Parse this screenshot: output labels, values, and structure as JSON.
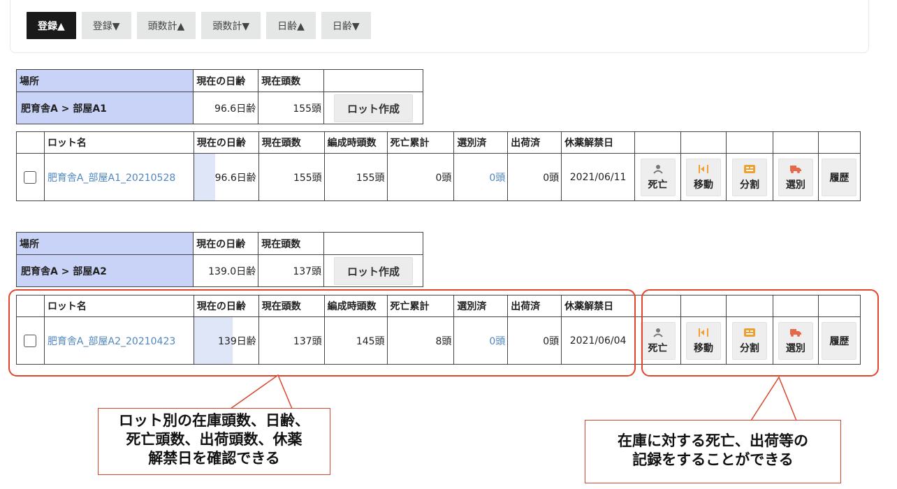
{
  "sort_buttons": [
    "登録▲",
    "登録▼",
    "頭数計▲",
    "頭数計▼",
    "日齢▲",
    "日齢▼"
  ],
  "loc_headers": {
    "place": "場所",
    "age": "現在の日齢",
    "count": "現在頭数"
  },
  "lot_headers": [
    "ロット名",
    "現在の日齢",
    "現在頭数",
    "編成時頭数",
    "死亡累計",
    "選別済",
    "出荷済",
    "休薬解禁日"
  ],
  "create_lot_label": "ロット作成",
  "actions": [
    "死亡",
    "移動",
    "分割",
    "選別",
    "履歴"
  ],
  "groups": [
    {
      "location": "肥育舎A > 部屋A1",
      "loc_age": "96.6日齢",
      "loc_count": "155頭",
      "lot": {
        "name": "肥育舎A_部屋A1_20210528",
        "age": "96.6日齢",
        "age_fraction": 0.33,
        "count": "155頭",
        "initial": "155頭",
        "deaths": "0頭",
        "selected": "0頭",
        "shipped": "0頭",
        "release_date": "2021/06/11"
      }
    },
    {
      "location": "肥育舎A > 部屋A2",
      "loc_age": "139.0日齢",
      "loc_count": "137頭",
      "lot": {
        "name": "肥育舎A_部屋A2_20210423",
        "age": "139日齢",
        "age_fraction": 0.6,
        "count": "137頭",
        "initial": "145頭",
        "deaths": "8頭",
        "selected": "0頭",
        "shipped": "0頭",
        "release_date": "2021/06/04"
      }
    }
  ],
  "callouts": {
    "left": [
      "ロット別の在庫頭数、日齢、",
      "死亡頭数、出荷頭数、休薬",
      "解禁日を確認できる"
    ],
    "right": [
      "在庫に対する死亡、出荷等の",
      "記録をすることができる"
    ]
  },
  "colors": {
    "location_bg": "#c9d3f8",
    "link": "#4f86c0",
    "annotation": "#e2452b",
    "active_sort": "#1a1a1a"
  }
}
